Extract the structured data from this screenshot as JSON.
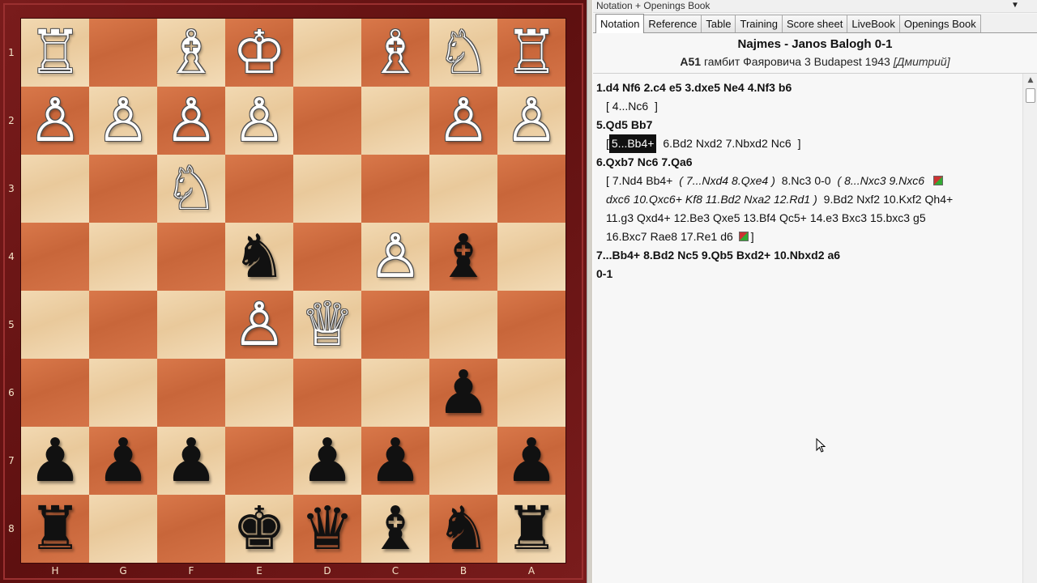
{
  "board": {
    "ranks": [
      "1",
      "2",
      "3",
      "4",
      "5",
      "6",
      "7",
      "8"
    ],
    "files": [
      "H",
      "G",
      "F",
      "E",
      "D",
      "C",
      "B",
      "A"
    ],
    "squares": [
      [
        "♖",
        "",
        "♗",
        "♔",
        "",
        "♗",
        "♘",
        "♖"
      ],
      [
        "♙",
        "♙",
        "♙",
        "♙",
        "",
        "",
        "♙",
        "♙"
      ],
      [
        "",
        "",
        "♘",
        "",
        "",
        "",
        "",
        ""
      ],
      [
        "",
        "",
        "",
        "♞",
        "",
        "♙",
        "♝",
        ""
      ],
      [
        "",
        "",
        "",
        "♙",
        "♕",
        "",
        "",
        ""
      ],
      [
        "",
        "",
        "",
        "",
        "",
        "",
        "♟",
        ""
      ],
      [
        "♟",
        "♟",
        "♟",
        "",
        "♟",
        "♟",
        "",
        "♟"
      ],
      [
        "♜",
        "",
        "",
        "♚",
        "♛",
        "♝",
        "♞",
        "♜"
      ]
    ]
  },
  "panel": {
    "title": "Notation + Openings Book",
    "dropdown_glyph": "▼",
    "tabs": [
      "Notation",
      "Reference",
      "Table",
      "Training",
      "Score sheet",
      "LiveBook",
      "Openings Book"
    ],
    "active_tab": 0
  },
  "game": {
    "players": "Najmes - Janos Balogh  0-1",
    "eco": "A51",
    "event_text": "гамбит Фаяровича 3 Budapest 1943",
    "annotator": "[Дмитрий]"
  },
  "notation": {
    "l1": [
      "1.d4",
      "Nf6",
      "2.c4",
      "e5",
      "3.dxe5",
      "Ne4",
      "4.Nf3",
      "b6"
    ],
    "l2_open": "[",
    "l2": [
      "4...Nc6"
    ],
    "l2_close": "]",
    "l3": [
      "5.Qd5",
      "Bb7"
    ],
    "l4_open": "[",
    "l4_sel": "5...Bb4+",
    "l4": [
      "6.Bd2",
      "Nxd2",
      "7.Nbxd2",
      "Nc6"
    ],
    "l4_close": "]",
    "l5": [
      "6.Qxb7",
      "Nc6",
      "7.Qa6"
    ],
    "l6_a": [
      "[",
      "7.Nd4",
      "Bb4+"
    ],
    "l6_it": [
      "(",
      "7...Nxd4",
      "8.Qxe4",
      ")"
    ],
    "l6_b": [
      "8.Nc3",
      "0-0"
    ],
    "l6_it2": [
      "(",
      "8...Nxc3",
      "9.Nxc6"
    ],
    "l7_it": [
      "dxc6",
      "10.Qxc6+",
      "Kf8",
      "11.Bd2",
      "Nxa2",
      "12.Rd1",
      ")"
    ],
    "l7": [
      "9.Bd2",
      "Nxf2",
      "10.Kxf2",
      "Qh4+"
    ],
    "l8": [
      "11.g3",
      "Qxd4+",
      "12.Be3",
      "Qxe5",
      "13.Bf4",
      "Qc5+",
      "14.e3",
      "Bxc3",
      "15.bxc3",
      "g5"
    ],
    "l9": [
      "16.Bxc7",
      "Rae8",
      "17.Re1",
      "d6"
    ],
    "l9_close": "]",
    "l10": [
      "7...Bb4+",
      "8.Bd2",
      "Nc5",
      "9.Qb5",
      "Bxd2+",
      "10.Nbxd2",
      "a6"
    ],
    "result": "0-1"
  },
  "scrollbar": {
    "up_glyph": "▲"
  }
}
